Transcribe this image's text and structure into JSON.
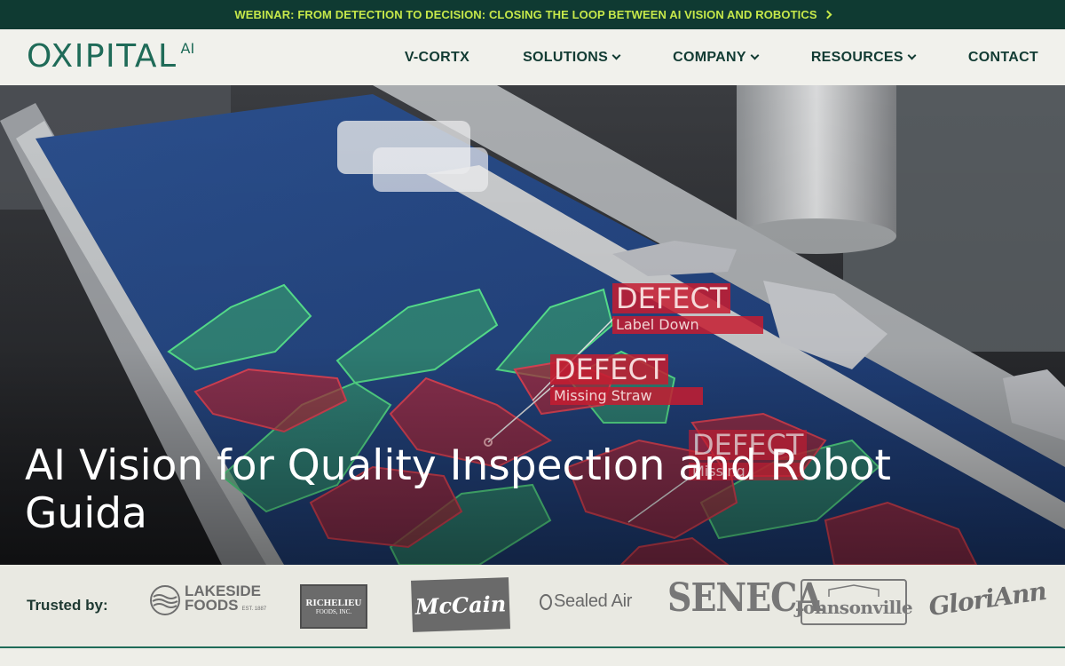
{
  "announcement": {
    "text": "WEBINAR: FROM DETECTION TO DECISION: CLOSING THE LOOP BETWEEN AI VISION AND ROBOTICS"
  },
  "logo": {
    "main": "OXIPITAL",
    "suffix": "AI"
  },
  "nav": {
    "items": [
      {
        "label": "V-CORTX",
        "has_dropdown": false
      },
      {
        "label": "SOLUTIONS",
        "has_dropdown": true
      },
      {
        "label": "COMPANY",
        "has_dropdown": true
      },
      {
        "label": "RESOURCES",
        "has_dropdown": true
      },
      {
        "label": "CONTACT",
        "has_dropdown": false
      }
    ]
  },
  "hero": {
    "title": "AI Vision for Quality Inspection and Robot Guida",
    "tags": [
      {
        "word": "DEFECT",
        "reason": "Label Down"
      },
      {
        "word": "DEFECT",
        "reason": "Missing Straw"
      },
      {
        "word": "DEFECT",
        "reason": "Missing"
      }
    ]
  },
  "trusted": {
    "label": "Trusted by:",
    "brands": [
      {
        "name": "LAKESIDE",
        "name2": "FOODS",
        "note": "EST. 1887"
      },
      {
        "name": "RICHELIEU",
        "name2": "FOODS, INC."
      },
      {
        "name": "McCain"
      },
      {
        "name": "Sealed Air"
      },
      {
        "name": "SENECA"
      },
      {
        "name": "Johnsonville"
      },
      {
        "name": "GloriAnn"
      }
    ]
  },
  "colors": {
    "announce_bg": "#0f3a32",
    "announce_text": "#c6e84a",
    "brand_green": "#1f6b58",
    "defect_red": "#c61c30",
    "ok_green": "#3fb37a"
  }
}
